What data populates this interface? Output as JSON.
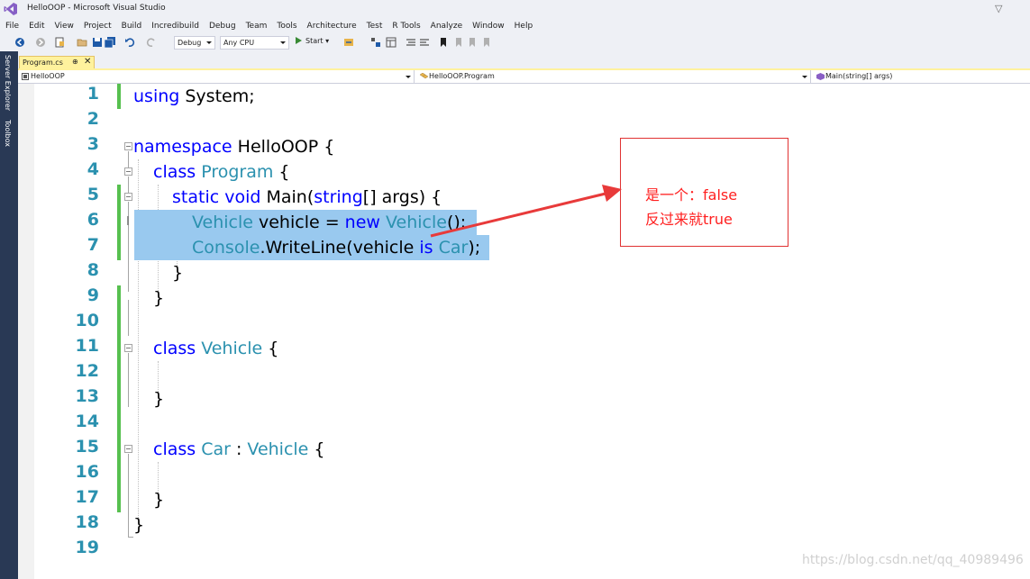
{
  "window": {
    "title": "HelloOOP - Microsoft Visual Studio",
    "filter_icon": "▽"
  },
  "menu": [
    "File",
    "Edit",
    "View",
    "Project",
    "Build",
    "Incredibuild",
    "Debug",
    "Team",
    "Tools",
    "Architecture",
    "Test",
    "R Tools",
    "Analyze",
    "Window",
    "Help"
  ],
  "toolbar": {
    "config": "Debug",
    "platform": "Any CPU",
    "start_label": "Start"
  },
  "side_tabs": [
    "Server Explorer",
    "Toolbox"
  ],
  "tab": {
    "label": "Program.cs",
    "pin": "⊕",
    "close": "✕"
  },
  "nav": {
    "project": "HelloOOP",
    "type": "HelloOOP.Program",
    "member": "Main(string[] args)"
  },
  "line_numbers": [
    "1",
    "2",
    "3",
    "4",
    "5",
    "6",
    "7",
    "8",
    "9",
    "10",
    "11",
    "12",
    "13",
    "14",
    "15",
    "16",
    "17",
    "18",
    "19"
  ],
  "code": {
    "l1_kw": "using",
    "l1_rest": " System;",
    "l3_kw": "namespace",
    "l3_rest": " HelloOOP {",
    "l4_kw": "class",
    "l4_ty": " Program",
    "l4_rest": " {",
    "l5_kw1": "static",
    "l5_kw2": " void",
    "l5_mid": " Main(",
    "l5_kw3": "string",
    "l5_rest": "[] args) {",
    "l6_ty1": "Vehicle",
    "l6_mid": " vehicle = ",
    "l6_kw": "new",
    "l6_ty2": " Vehicle",
    "l6_rest": "();",
    "l7_ty": "Console",
    "l7_mid": ".WriteLine(vehicle ",
    "l7_kw": "is",
    "l7_ty2": " Car",
    "l7_rest": ");",
    "l8": "}",
    "l9": "}",
    "l11_kw": "class",
    "l11_ty": " Vehicle",
    "l11_rest": " {",
    "l13": "}",
    "l15_kw": "class",
    "l15_ty": " Car",
    "l15_mid": " : ",
    "l15_ty2": "Vehicle",
    "l15_rest": " {",
    "l17": "}",
    "l18": "}"
  },
  "annotation": {
    "line1": "是一个：false",
    "line2": "反过来就true",
    "color": "#ff2020"
  },
  "watermark": "https://blog.csdn.net/qq_40989496"
}
